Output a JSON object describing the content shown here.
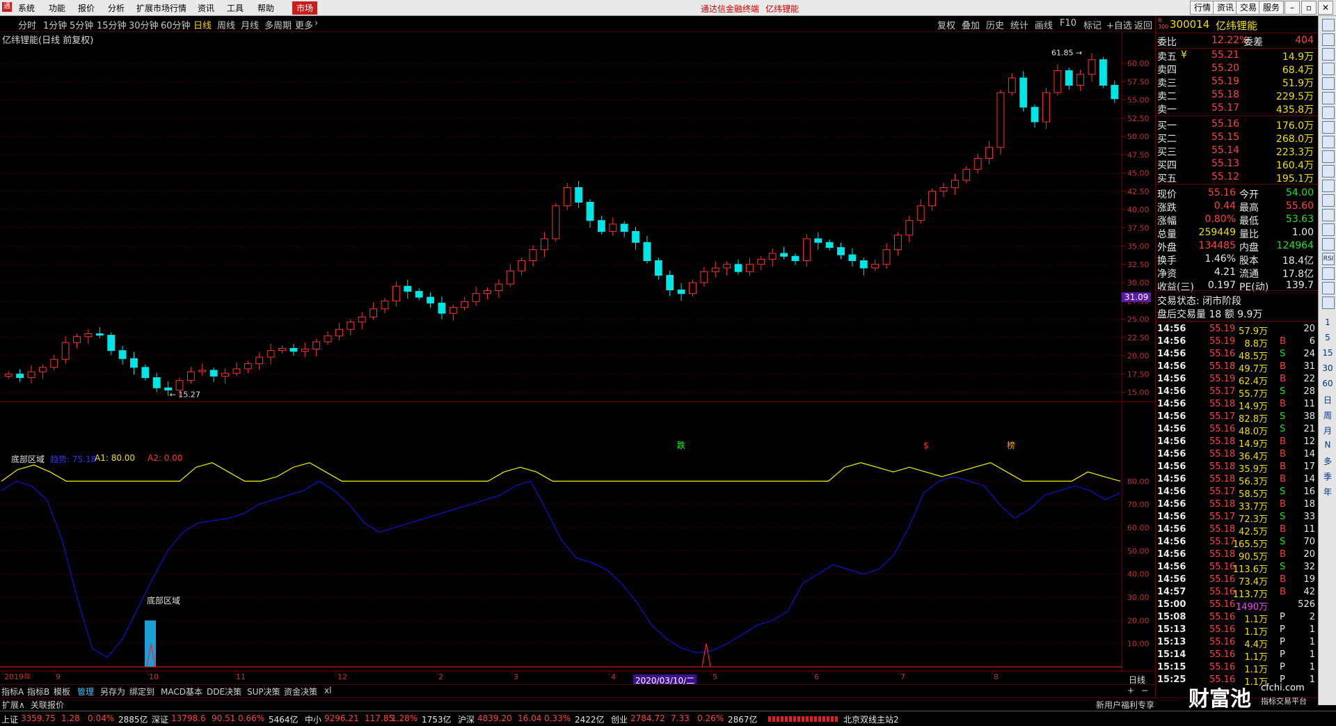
{
  "menubar": {
    "items": [
      "系统",
      "功能",
      "报价",
      "分析",
      "扩展市场行情",
      "资讯",
      "工具",
      "帮助"
    ],
    "market": "市场",
    "title_left": "通达信金融终端",
    "title_right": "亿纬锂能",
    "right_buttons": [
      "行情",
      "资讯",
      "交易",
      "服务"
    ]
  },
  "periods": [
    "分时",
    "1分钟",
    "5分钟",
    "15分钟",
    "30分钟",
    "60分钟",
    "日线",
    "周线",
    "月线",
    "多周期",
    "更多"
  ],
  "active_period": "日线",
  "toolbar": [
    "复权",
    "叠加",
    "历史",
    "统计",
    "画线",
    "F10",
    "标记",
    "+自选",
    "返回"
  ],
  "chart": {
    "stock_label": "亿纬锂能(日线 前复权)",
    "high_label": "61.85",
    "low_label": "15.27",
    "last_price_tag": "31.09",
    "y_axis_ticks": [
      "60.00",
      "57.50",
      "55.00",
      "52.50",
      "50.00",
      "47.50",
      "45.00",
      "42.50",
      "40.00",
      "37.50",
      "35.00",
      "32.50",
      "30.00",
      "27.50",
      "25.00",
      "22.50",
      "20.00",
      "17.50",
      "15.00"
    ],
    "signals": [
      {
        "text": "跌",
        "color": "#00ff00"
      },
      {
        "text": "$",
        "color": "#ff3030"
      },
      {
        "text": "榜",
        "color": "#ffa000"
      }
    ]
  },
  "indicator": {
    "name": "底部区域",
    "param1": "趋势: 75.18",
    "param2": "A1: 80.00",
    "param3": "A2: 0.00",
    "annotation": "底部区域",
    "y_axis_ticks": [
      "80.00",
      "70.00",
      "60.00",
      "50.00",
      "40.00",
      "30.00",
      "20.00",
      "10.00"
    ]
  },
  "x_axis": {
    "labels": [
      "2019年",
      "9",
      "10",
      "11",
      "12",
      "2",
      "3",
      "4",
      "5",
      "6",
      "7",
      "8"
    ],
    "cursor_date": "2020/03/10/二",
    "period_label": "日线"
  },
  "chart_data": {
    "type": "candlestick",
    "title": "亿纬锂能(日线 前复权)",
    "ylim": [
      14,
      62
    ],
    "x_labels": [
      "2019年",
      "9",
      "10",
      "11",
      "12",
      "2",
      "3",
      "4",
      "5",
      "6",
      "7",
      "8"
    ],
    "max_label": 61.85,
    "min_label": 15.27,
    "close_series": [
      17.5,
      17.0,
      17.8,
      18.4,
      19.5,
      21.8,
      22.6,
      23.0,
      22.8,
      20.7,
      19.6,
      18.4,
      17.0,
      15.6,
      15.3,
      16.6,
      17.8,
      18.0,
      17.2,
      17.6,
      18.2,
      18.9,
      19.8,
      20.7,
      21.0,
      20.6,
      20.9,
      21.9,
      22.7,
      23.6,
      24.6,
      25.3,
      26.4,
      27.5,
      29.5,
      28.8,
      28.0,
      27.2,
      25.8,
      26.6,
      27.4,
      28.5,
      28.9,
      29.8,
      31.6,
      33.0,
      34.5,
      36.0,
      40.5,
      43.0,
      41.0,
      38.5,
      37.0,
      38.0,
      37.0,
      35.5,
      33.0,
      31.0,
      29.0,
      28.5,
      30.0,
      31.5,
      32.0,
      32.5,
      31.5,
      32.5,
      33.2,
      34.0,
      33.6,
      33.0,
      36.0,
      35.5,
      34.8,
      33.8,
      33.0,
      32.0,
      32.5,
      34.5,
      36.5,
      38.5,
      40.5,
      42.5,
      43.0,
      44.0,
      45.5,
      47.0,
      48.5,
      56.0,
      58.0,
      54.0,
      52.0,
      56.0,
      59.0,
      57.0,
      58.5,
      60.5,
      57.0,
      55.16
    ],
    "indicator_series": [
      {
        "name": "趋势",
        "color": "#1010c0",
        "values": [
          76,
          80,
          78,
          72,
          55,
          30,
          8,
          4,
          12,
          25,
          38,
          50,
          58,
          62,
          63,
          64,
          66,
          70,
          72,
          74,
          76,
          80,
          76,
          70,
          62,
          58,
          60,
          62,
          64,
          66,
          68,
          70,
          72,
          74,
          78,
          80,
          68,
          55,
          47,
          45,
          42,
          36,
          28,
          18,
          12,
          8,
          6,
          7,
          10,
          14,
          18,
          20,
          24,
          36,
          40,
          44,
          42,
          40,
          42,
          48,
          60,
          75,
          80,
          82,
          80,
          78,
          70,
          64,
          68,
          74,
          76,
          78,
          76,
          72,
          75
        ]
      },
      {
        "name": "A1",
        "color": "#e0e000",
        "values": [
          80,
          85,
          87,
          84,
          80,
          80,
          80,
          80,
          80,
          80,
          80,
          80,
          86,
          88,
          84,
          80,
          80,
          82,
          86,
          88,
          84,
          80,
          80,
          80,
          80,
          80,
          80,
          80,
          80,
          80,
          80,
          84,
          86,
          84,
          80,
          80,
          80,
          80,
          80,
          80,
          80,
          80,
          80,
          80,
          80,
          80,
          80,
          80,
          80,
          80,
          80,
          80,
          86,
          88,
          86,
          84,
          86,
          84,
          82,
          84,
          86,
          88,
          84,
          80,
          80,
          80,
          80,
          84,
          82,
          80
        ]
      }
    ]
  },
  "quote": {
    "code": "300014",
    "name": "亿纬锂能",
    "weibi_label": "委比",
    "weibi_value": "12.22%",
    "weicha_label": "委差",
    "weicha_value": "404",
    "asks": [
      {
        "label": "卖五",
        "flag": "¥",
        "price": "55.21",
        "vol": "14.9万"
      },
      {
        "label": "卖四",
        "flag": "",
        "price": "55.20",
        "vol": "68.4万"
      },
      {
        "label": "卖三",
        "flag": "",
        "price": "55.19",
        "vol": "51.9万"
      },
      {
        "label": "卖二",
        "flag": "",
        "price": "55.18",
        "vol": "229.5万"
      },
      {
        "label": "卖一",
        "flag": "",
        "price": "55.17",
        "vol": "435.8万"
      }
    ],
    "bids": [
      {
        "label": "买一",
        "price": "55.16",
        "vol": "176.0万"
      },
      {
        "label": "买二",
        "price": "55.15",
        "vol": "268.0万"
      },
      {
        "label": "买三",
        "price": "55.14",
        "vol": "223.3万"
      },
      {
        "label": "买四",
        "price": "55.13",
        "vol": "160.4万"
      },
      {
        "label": "买五",
        "price": "55.12",
        "vol": "195.1万"
      }
    ],
    "stats": [
      {
        "l1": "现价",
        "v1": "55.16",
        "c1": "red",
        "l2": "今开",
        "v2": "54.00",
        "c2": "grn"
      },
      {
        "l1": "涨跌",
        "v1": "0.44",
        "c1": "red",
        "l2": "最高",
        "v2": "55.60",
        "c2": "red"
      },
      {
        "l1": "涨幅",
        "v1": "0.80%",
        "c1": "red",
        "l2": "最低",
        "v2": "53.63",
        "c2": "grn"
      },
      {
        "l1": "总量",
        "v1": "259449",
        "c1": "yel",
        "l2": "量比",
        "v2": "1.00",
        "c2": "wht"
      },
      {
        "l1": "外盘",
        "v1": "134485",
        "c1": "red",
        "l2": "内盘",
        "v2": "124964",
        "c2": "grn"
      },
      {
        "l1": "换手",
        "v1": "1.46%",
        "c1": "wht",
        "l2": "股本",
        "v2": "18.4亿",
        "c2": "wht"
      },
      {
        "l1": "净资",
        "v1": "4.21",
        "c1": "wht",
        "l2": "流通",
        "v2": "17.8亿",
        "c2": "wht"
      },
      {
        "l1": "收益(三)",
        "v1": "0.197",
        "c1": "wht",
        "l2": "PE(动)",
        "v2": "139.7",
        "c2": "wht"
      }
    ],
    "trade_state": "交易状态: 闭市阶段",
    "after_hours": "盘后交易量 18 额 9.9万"
  },
  "ticks": [
    {
      "t": "14:56",
      "p": "55.19",
      "v": "57.9万",
      "s": "",
      "n": "20"
    },
    {
      "t": "14:56",
      "p": "55.19",
      "v": "8.8万",
      "s": "B",
      "n": "6"
    },
    {
      "t": "14:56",
      "p": "55.16",
      "v": "48.5万",
      "s": "S",
      "n": "24"
    },
    {
      "t": "14:56",
      "p": "55.18",
      "v": "49.7万",
      "s": "B",
      "n": "31"
    },
    {
      "t": "14:56",
      "p": "55.19",
      "v": "62.4万",
      "s": "B",
      "n": "22"
    },
    {
      "t": "14:56",
      "p": "55.17",
      "v": "55.7万",
      "s": "S",
      "n": "28"
    },
    {
      "t": "14:56",
      "p": "55.18",
      "v": "14.9万",
      "s": "B",
      "n": "11"
    },
    {
      "t": "14:56",
      "p": "55.17",
      "v": "82.8万",
      "s": "S",
      "n": "38"
    },
    {
      "t": "14:56",
      "p": "55.16",
      "v": "48.0万",
      "s": "S",
      "n": "21"
    },
    {
      "t": "14:56",
      "p": "55.18",
      "v": "14.9万",
      "s": "B",
      "n": "12"
    },
    {
      "t": "14:56",
      "p": "55.18",
      "v": "36.4万",
      "s": "B",
      "n": "14"
    },
    {
      "t": "14:56",
      "p": "55.18",
      "v": "35.9万",
      "s": "B",
      "n": "17"
    },
    {
      "t": "14:56",
      "p": "55.18",
      "v": "56.3万",
      "s": "B",
      "n": "14"
    },
    {
      "t": "14:56",
      "p": "55.17",
      "v": "58.5万",
      "s": "S",
      "n": "16"
    },
    {
      "t": "14:56",
      "p": "55.18",
      "v": "33.7万",
      "s": "B",
      "n": "18"
    },
    {
      "t": "14:56",
      "p": "55.17",
      "v": "72.3万",
      "s": "S",
      "n": "33"
    },
    {
      "t": "14:56",
      "p": "55.18",
      "v": "42.5万",
      "s": "B",
      "n": "11"
    },
    {
      "t": "14:56",
      "p": "55.17",
      "v": "165.5万",
      "s": "S",
      "n": "70"
    },
    {
      "t": "14:56",
      "p": "55.18",
      "v": "90.5万",
      "s": "B",
      "n": "20"
    },
    {
      "t": "14:56",
      "p": "55.16",
      "v": "113.6万",
      "s": "S",
      "n": "32"
    },
    {
      "t": "14:56",
      "p": "55.16",
      "v": "73.4万",
      "s": "B",
      "n": "19"
    },
    {
      "t": "14:57",
      "p": "55.16",
      "v": "113.7万",
      "s": "B",
      "n": "42"
    },
    {
      "t": "15:00",
      "p": "55.16",
      "v": "1490万",
      "s": "",
      "n": "526"
    },
    {
      "t": "15:08",
      "p": "55.16",
      "v": "1.1万",
      "s": "P",
      "n": "2"
    },
    {
      "t": "15:13",
      "p": "55.16",
      "v": "1.1万",
      "s": "P",
      "n": "1"
    },
    {
      "t": "15:13",
      "p": "55.16",
      "v": "4.4万",
      "s": "P",
      "n": "1"
    },
    {
      "t": "15:14",
      "p": "55.16",
      "v": "1.1万",
      "s": "P",
      "n": "1"
    },
    {
      "t": "15:15",
      "p": "55.16",
      "v": "1.1万",
      "s": "P",
      "n": "1"
    },
    {
      "t": "15:25",
      "p": "55.16",
      "v": "1.1万",
      "s": "P",
      "n": "1"
    }
  ],
  "indicator_tabs": [
    "指标A",
    "指标B",
    "模板",
    "管理",
    "另存为",
    "绑定到",
    "MACD基本",
    "DDE决策",
    "SUP决策",
    "资金决策",
    "xl"
  ],
  "active_indicator_tab": "管理",
  "ext_bar": [
    "扩展∧",
    "关联报价"
  ],
  "ext_right": "新用户福利专享",
  "status": [
    {
      "name": "上证",
      "v1": "3359.75",
      "v2": "1.28",
      "v3": "0.04%",
      "amt": "2885亿"
    },
    {
      "name": "深证",
      "v1": "13798.6",
      "v2": "90.51",
      "v3": "0.66%",
      "amt": "5464亿"
    },
    {
      "name": "中小",
      "v1": "9296.21",
      "v2": "117.85",
      "v3": "1.28%",
      "amt": "1753亿"
    },
    {
      "name": "沪深",
      "v1": "4839.20",
      "v2": "16.04",
      "v3": "0.33%",
      "amt": "2422亿"
    },
    {
      "name": "创业",
      "v1": "2784.72",
      "v2": "7.33",
      "v3": "0.26%",
      "amt": "2867亿"
    }
  ],
  "server": "北京双线主站2",
  "right_tools": [
    "1",
    "5",
    "15",
    "30",
    "60",
    "日",
    "周",
    "月",
    "N",
    "多",
    "季",
    "年"
  ],
  "watermark": {
    "brand": "财富池",
    "site": "cfchi.com",
    "sub": "指标交易平台"
  }
}
